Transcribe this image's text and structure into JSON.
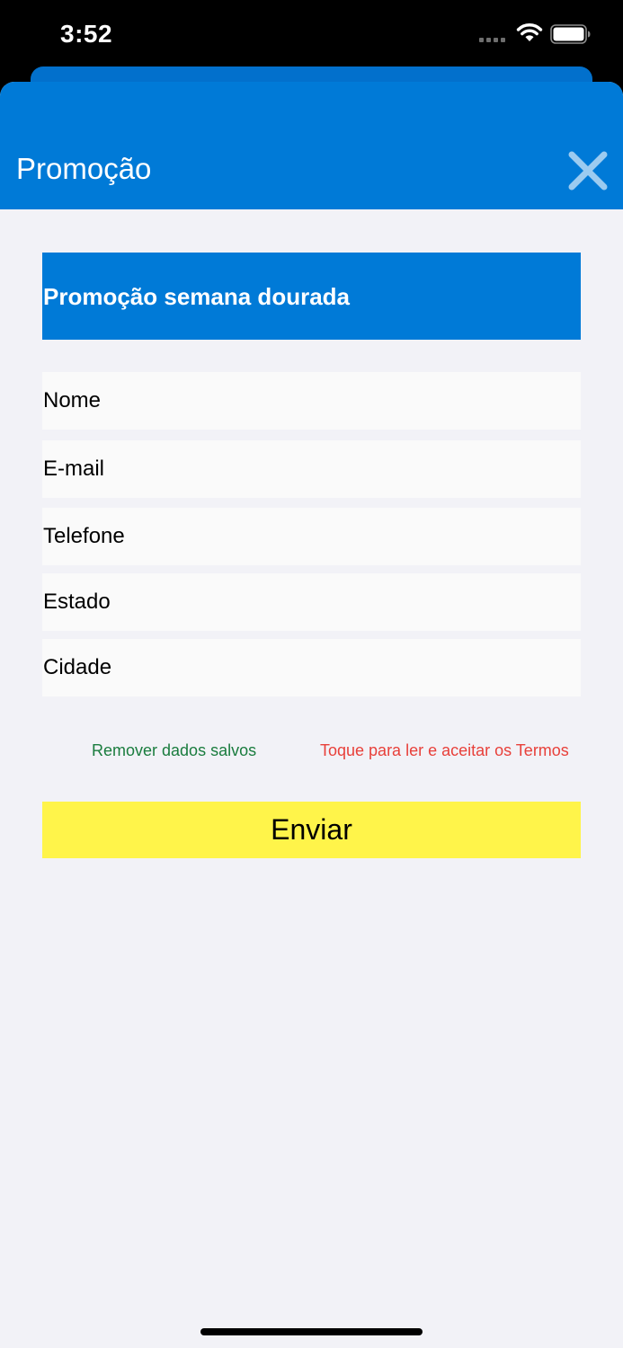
{
  "status_bar": {
    "time": "3:52"
  },
  "header": {
    "title": "Promoção",
    "close_icon": "close-icon"
  },
  "banner": {
    "text": "Promoção semana dourada"
  },
  "form": {
    "fields": [
      {
        "placeholder": "Nome",
        "value": ""
      },
      {
        "placeholder": "E-mail",
        "value": ""
      },
      {
        "placeholder": "Telefone",
        "value": ""
      },
      {
        "placeholder": "Estado",
        "value": ""
      },
      {
        "placeholder": "Cidade",
        "value": ""
      }
    ],
    "remove_saved_label": "Remover dados salvos",
    "terms_label": "Toque para ler e aceitar os Termos",
    "submit_label": "Enviar"
  },
  "colors": {
    "header_bg": "#007ad7",
    "page_bg": "#f2f2f7",
    "submit_bg": "#fff44a",
    "remove_link": "#1a7c3e",
    "terms_link": "#e8403a"
  }
}
